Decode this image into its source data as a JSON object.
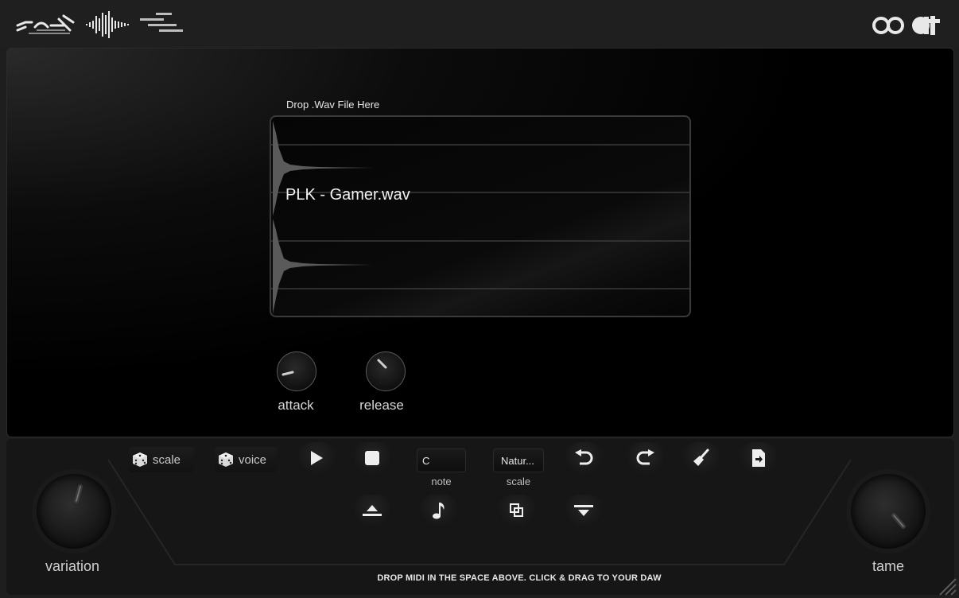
{
  "header": {
    "logo_alt": "ridge batch"
  },
  "wav_panel": {
    "drop_label": "Drop .Wav File Here",
    "file_name": "PLK - Gamer.wav"
  },
  "envelope": {
    "attack_label": "attack",
    "release_label": "release"
  },
  "controls": {
    "scale_dice_label": "scale",
    "voice_dice_label": "voice",
    "note_value": "C",
    "note_label": "note",
    "scale_value": "Natur...",
    "scale_label": "scale"
  },
  "knobs": {
    "variation_label": "variation",
    "tame_label": "tame"
  },
  "footer": {
    "instruction": "DROP MIDI IN THE SPACE ABOVE. CLICK & DRAG TO YOUR DAW"
  },
  "colors": {
    "background": "#1e1e1e",
    "panel": "#000000",
    "accent": "#e6e6e6"
  },
  "icons": [
    "logo-icon",
    "waveform-icon",
    "bars-icon",
    "brand-icon",
    "dice-icon",
    "play-icon",
    "stop-icon",
    "undo-icon",
    "redo-icon",
    "clear-icon",
    "export-icon",
    "align-top-icon",
    "music-note-icon",
    "copy-icon",
    "align-bottom-icon"
  ]
}
